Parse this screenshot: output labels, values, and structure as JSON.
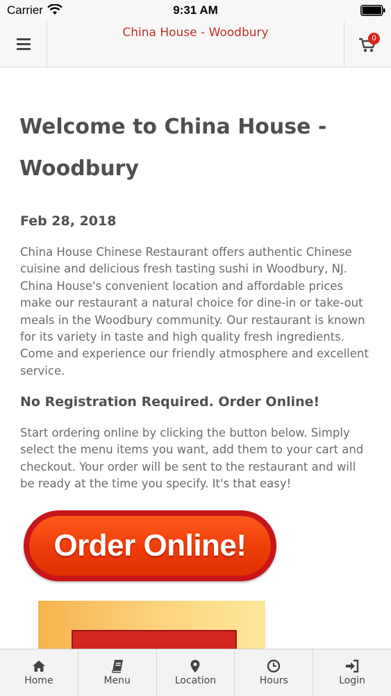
{
  "status_bar": {
    "carrier": "Carrier",
    "time": "9:31 AM"
  },
  "header": {
    "title": "China House - Woodbury",
    "cart_count": "0",
    "accent_color": "#c4302b"
  },
  "main": {
    "welcome_title": "Welcome to China House - Woodbury",
    "date": "Feb 28, 2018",
    "intro": "China House Chinese Restaurant offers authentic Chinese cuisine and delicious fresh tasting sushi in Woodbury, NJ.  China House's convenient location and affordable prices make our restaurant a natural choice for dine-in or take-out meals in the Woodbury community.  Our restaurant is known for its variety in taste and high quality fresh ingredients. Come and experience our friendly atmosphere and excellent service.",
    "subheading": "No Registration Required. Order Online!",
    "instructions": "Start ordering online by clicking the button below. Simply select the menu items you want, add them to your cart and checkout. Your order will be sent to the restaurant and will be ready at the time you specify. It's that easy!",
    "order_button_label": "Order Online!"
  },
  "tab_bar": {
    "tabs": [
      {
        "label": "Home",
        "icon": "home-icon"
      },
      {
        "label": "Menu",
        "icon": "book-icon"
      },
      {
        "label": "Location",
        "icon": "map-pin-icon"
      },
      {
        "label": "Hours",
        "icon": "clock-icon"
      },
      {
        "label": "Login",
        "icon": "login-icon"
      }
    ]
  }
}
